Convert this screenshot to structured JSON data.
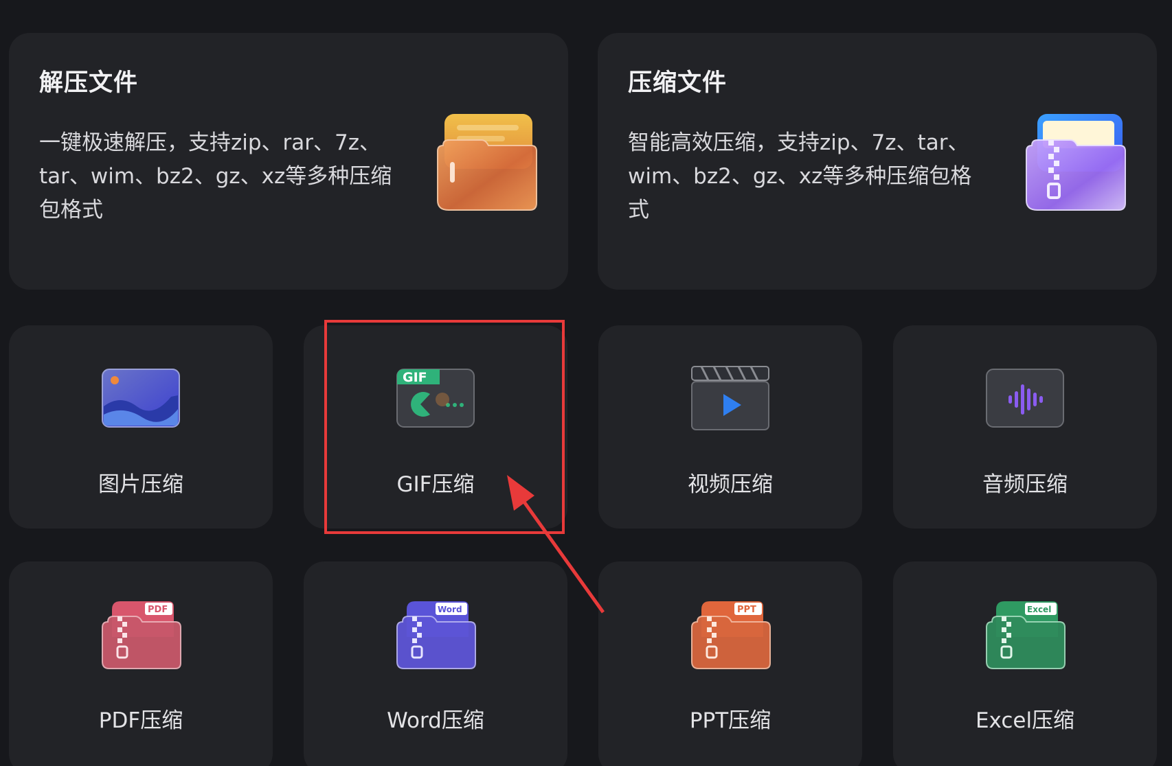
{
  "cards": {
    "extract": {
      "title": "解压文件",
      "desc": "一键极速解压，支持zip、rar、7z、tar、wim、bz2、gz、xz等多种压缩包格式",
      "icon": "folder-extract-icon"
    },
    "compress": {
      "title": "压缩文件",
      "desc": "智能高效压缩，支持zip、7z、tar、wim、bz2、gz、xz等多种压缩包格式",
      "icon": "folder-zip-icon"
    }
  },
  "tools": [
    {
      "label": "图片压缩",
      "icon": "image-icon"
    },
    {
      "label": "GIF压缩",
      "icon": "gif-icon",
      "badge": "GIF"
    },
    {
      "label": "视频压缩",
      "icon": "video-clapper-icon"
    },
    {
      "label": "音频压缩",
      "icon": "audio-wave-icon"
    },
    {
      "label": "PDF压缩",
      "icon": "pdf-zip-icon",
      "badge": "PDF"
    },
    {
      "label": "Word压缩",
      "icon": "word-zip-icon",
      "badge": "Word"
    },
    {
      "label": "PPT压缩",
      "icon": "ppt-zip-icon",
      "badge": "PPT"
    },
    {
      "label": "Excel压缩",
      "icon": "excel-zip-icon",
      "badge": "Excel"
    }
  ],
  "colors": {
    "background": "#17181c",
    "card": "#222327",
    "highlight": "#e83a3a",
    "pdf": "#d8566c",
    "word": "#5a54d8",
    "ppt": "#e0663c",
    "excel": "#2f9a62",
    "gif": "#2fb27a"
  }
}
